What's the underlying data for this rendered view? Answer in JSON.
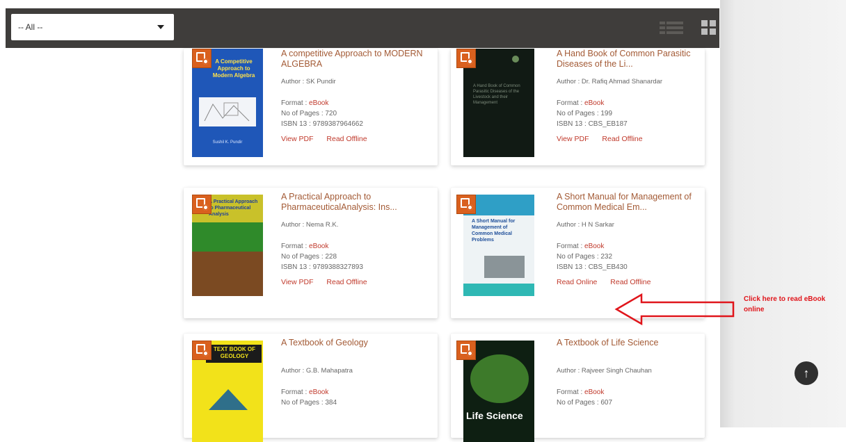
{
  "filter": {
    "selected": "-- All --"
  },
  "view_toggle": {
    "list_icon": "list-view-icon",
    "grid_icon": "grid-view-icon",
    "active": "grid"
  },
  "books": [
    {
      "title": "A competitive Approach to MODERN ALGEBRA",
      "author": "Author : SK Pundir",
      "format_label": "Format : ",
      "format_value": "eBook",
      "pages": "No of Pages : 720",
      "isbn": "ISBN 13 : 9789387964662",
      "action1": "View PDF",
      "action2": "Read Offline",
      "cover_text": "A Competitive Approach to Modern Algebra",
      "cover_author": "Sushil K. Pundir"
    },
    {
      "title": "A Hand Book of Common Parasitic Diseases of the Li...",
      "author": "Author : Dr. Rafiq Ahmad Shanardar",
      "format_label": "Format : ",
      "format_value": "eBook",
      "pages": "No of Pages : 199",
      "isbn": "ISBN 13 : CBS_EB187",
      "action1": "View PDF",
      "action2": "Read Offline",
      "cover_text": "A Hand Book of Common Parasitic Diseases of the Livestock and their Management"
    },
    {
      "title": "A Practical Approach to PharmaceuticalAnalysis: Ins...",
      "author": "Author : Nema R.K.",
      "format_label": "Format : ",
      "format_value": "eBook",
      "pages": "No of Pages : 228",
      "isbn": "ISBN 13 : 9789388327893",
      "action1": "View PDF",
      "action2": "Read Offline",
      "cover_text": "A Practical Approach to Pharmaceutical Analysis"
    },
    {
      "title": "A Short Manual for Management of Common Medical Em...",
      "author": "Author : H N Sarkar",
      "format_label": "Format : ",
      "format_value": "eBook",
      "pages": "No of Pages : 232",
      "isbn": "ISBN 13 : CBS_EB430",
      "action1": "Read Online",
      "action2": "Read Offline",
      "cover_text": "A Short Manual for Management of Common Medical Problems"
    },
    {
      "title": "A Textbook of Geology",
      "author": "Author : G.B. Mahapatra",
      "format_label": "Format : ",
      "format_value": "eBook",
      "pages": "No of Pages : 384",
      "cover_text": "TEXT BOOK OF GEOLOGY"
    },
    {
      "title": "A Textbook of Life Science",
      "author": "Author : Rajveer Singh Chauhan",
      "format_label": "Format : ",
      "format_value": "eBook",
      "pages": "No of Pages : 607",
      "cover_text": "Life Science"
    }
  ],
  "annotation": {
    "text": "Click here to read eBook online",
    "color": "#e0151b"
  },
  "scroll_top": {
    "icon": "arrow-up-icon",
    "glyph": "↑"
  }
}
